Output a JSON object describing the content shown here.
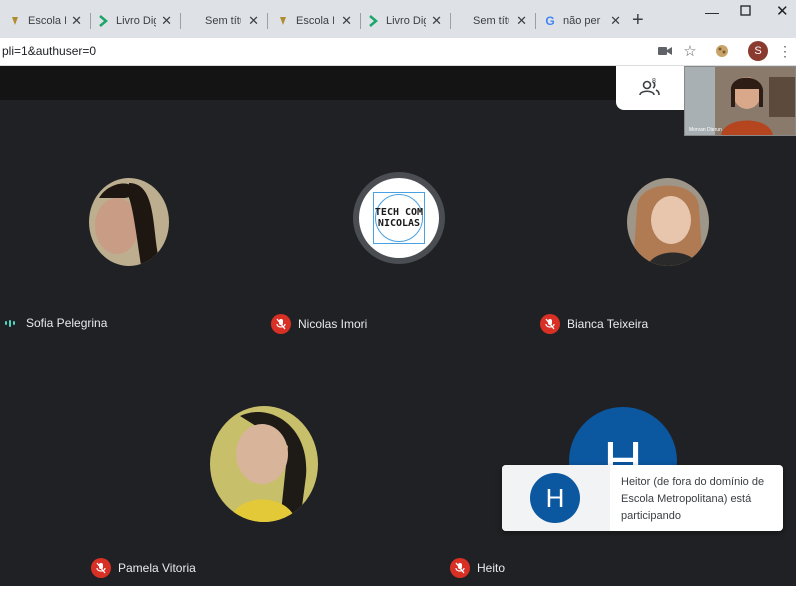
{
  "browser": {
    "tabs": [
      {
        "label": "Escola M",
        "icon": "escola-favicon",
        "active": false
      },
      {
        "label": "Livro Dig",
        "icon": "arrow-favicon",
        "active": false
      },
      {
        "label": "Sem títu",
        "icon": "",
        "active": false
      },
      {
        "label": "Escola M",
        "icon": "escola-favicon",
        "active": false
      },
      {
        "label": "Livro Dig",
        "icon": "arrow-favicon",
        "active": false
      },
      {
        "label": "Sem títu",
        "icon": "",
        "active": false
      },
      {
        "label": "não per",
        "icon": "google-favicon",
        "active": true
      }
    ],
    "new_tab": "+",
    "url": "pli=1&authuser=0",
    "profile_initial": "S",
    "colors": {
      "tabstrip": "#dee1e6",
      "profile": "#8b3a2f"
    }
  },
  "meet": {
    "participants_count": "8",
    "self_view_name": "Morvan Dierun",
    "participants": [
      {
        "name": "Sofia Pelegrina",
        "status": "speaking",
        "avatar": "photo"
      },
      {
        "name": "Nicolas Imori",
        "status": "muted",
        "avatar": "logo",
        "logo_text": "TECH COM NICOLAS"
      },
      {
        "name": "Bianca Teixeira",
        "status": "muted",
        "avatar": "photo"
      },
      {
        "name": "Pamela Vitoria",
        "status": "muted",
        "avatar": "photo"
      },
      {
        "name": "Heito",
        "status": "muted",
        "avatar": "initial",
        "initial": "H"
      }
    ],
    "toast": {
      "initial": "H",
      "message": "Heitor (de fora do domínio de Escola Metropolitana) está participando"
    },
    "colors": {
      "background": "#202124",
      "muted": "#d93025",
      "speaking": "#4fd6c0",
      "initial_avatar": "#0b57a0"
    }
  }
}
